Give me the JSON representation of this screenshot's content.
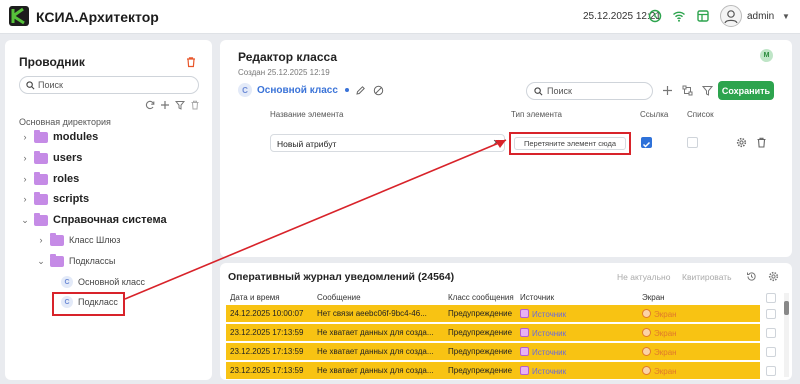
{
  "app": {
    "title": "КСИА.Архитектор",
    "datetime": "25.12.2025 12:21",
    "username": "admin"
  },
  "explorer": {
    "title": "Проводник",
    "search_placeholder": "Поиск",
    "root_label": "Основная директория",
    "items": [
      {
        "label": "modules"
      },
      {
        "label": "users"
      },
      {
        "label": "roles"
      },
      {
        "label": "scripts"
      },
      {
        "label": "Справочная система"
      },
      {
        "label": "Класс Шлюз"
      },
      {
        "label": "Подклассы"
      },
      {
        "label": "Основной класс",
        "badge": "C"
      },
      {
        "label": "Подкласс",
        "badge": "C"
      }
    ]
  },
  "editor": {
    "title": "Редактор класса",
    "created": "Создан 25.12.2025 12:19",
    "avatar": "M",
    "class_badge": "C",
    "class_name": "Основной класс",
    "search_placeholder": "Поиск",
    "save_label": "Сохранить",
    "columns": {
      "name": "Название элемента",
      "type": "Тип элемента",
      "link": "Ссылка",
      "list": "Список"
    },
    "row": {
      "name_value": "Новый атрибут",
      "type_placeholder": "Перетяните элемент сюда",
      "link_checked": true,
      "list_checked": false
    }
  },
  "journal": {
    "title": "Оперативный журнал уведомлений (24564)",
    "btn_not_actual": "Не актуально",
    "btn_quote": "Квитировать",
    "columns": {
      "datetime": "Дата и время",
      "message": "Сообщение",
      "class": "Класс сообщения",
      "source": "Источник",
      "screen": "Экран"
    },
    "rows": [
      {
        "datetime": "24.12.2025 10:00:07",
        "message": "Нет связи aeebc06f-9bc4-46...",
        "class": "Предупреждение",
        "source": "Источник",
        "screen": "Экран"
      },
      {
        "datetime": "23.12.2025 17:13:59",
        "message": "Не хватает данных для созда...",
        "class": "Предупреждение",
        "source": "Источник",
        "screen": "Экран"
      },
      {
        "datetime": "23.12.2025 17:13:59",
        "message": "Не хватает данных для созда...",
        "class": "Предупреждение",
        "source": "Источник",
        "screen": "Экран"
      },
      {
        "datetime": "23.12.2025 17:13:59",
        "message": "Не хватает данных для созда...",
        "class": "Предупреждение",
        "source": "Источник",
        "screen": "Экран"
      }
    ]
  },
  "colors": {
    "accent": "#2da44e",
    "link": "#3a73d8",
    "highlight": "#d8232a",
    "warning_row": "#f8c313",
    "folder": "#c58be6"
  }
}
